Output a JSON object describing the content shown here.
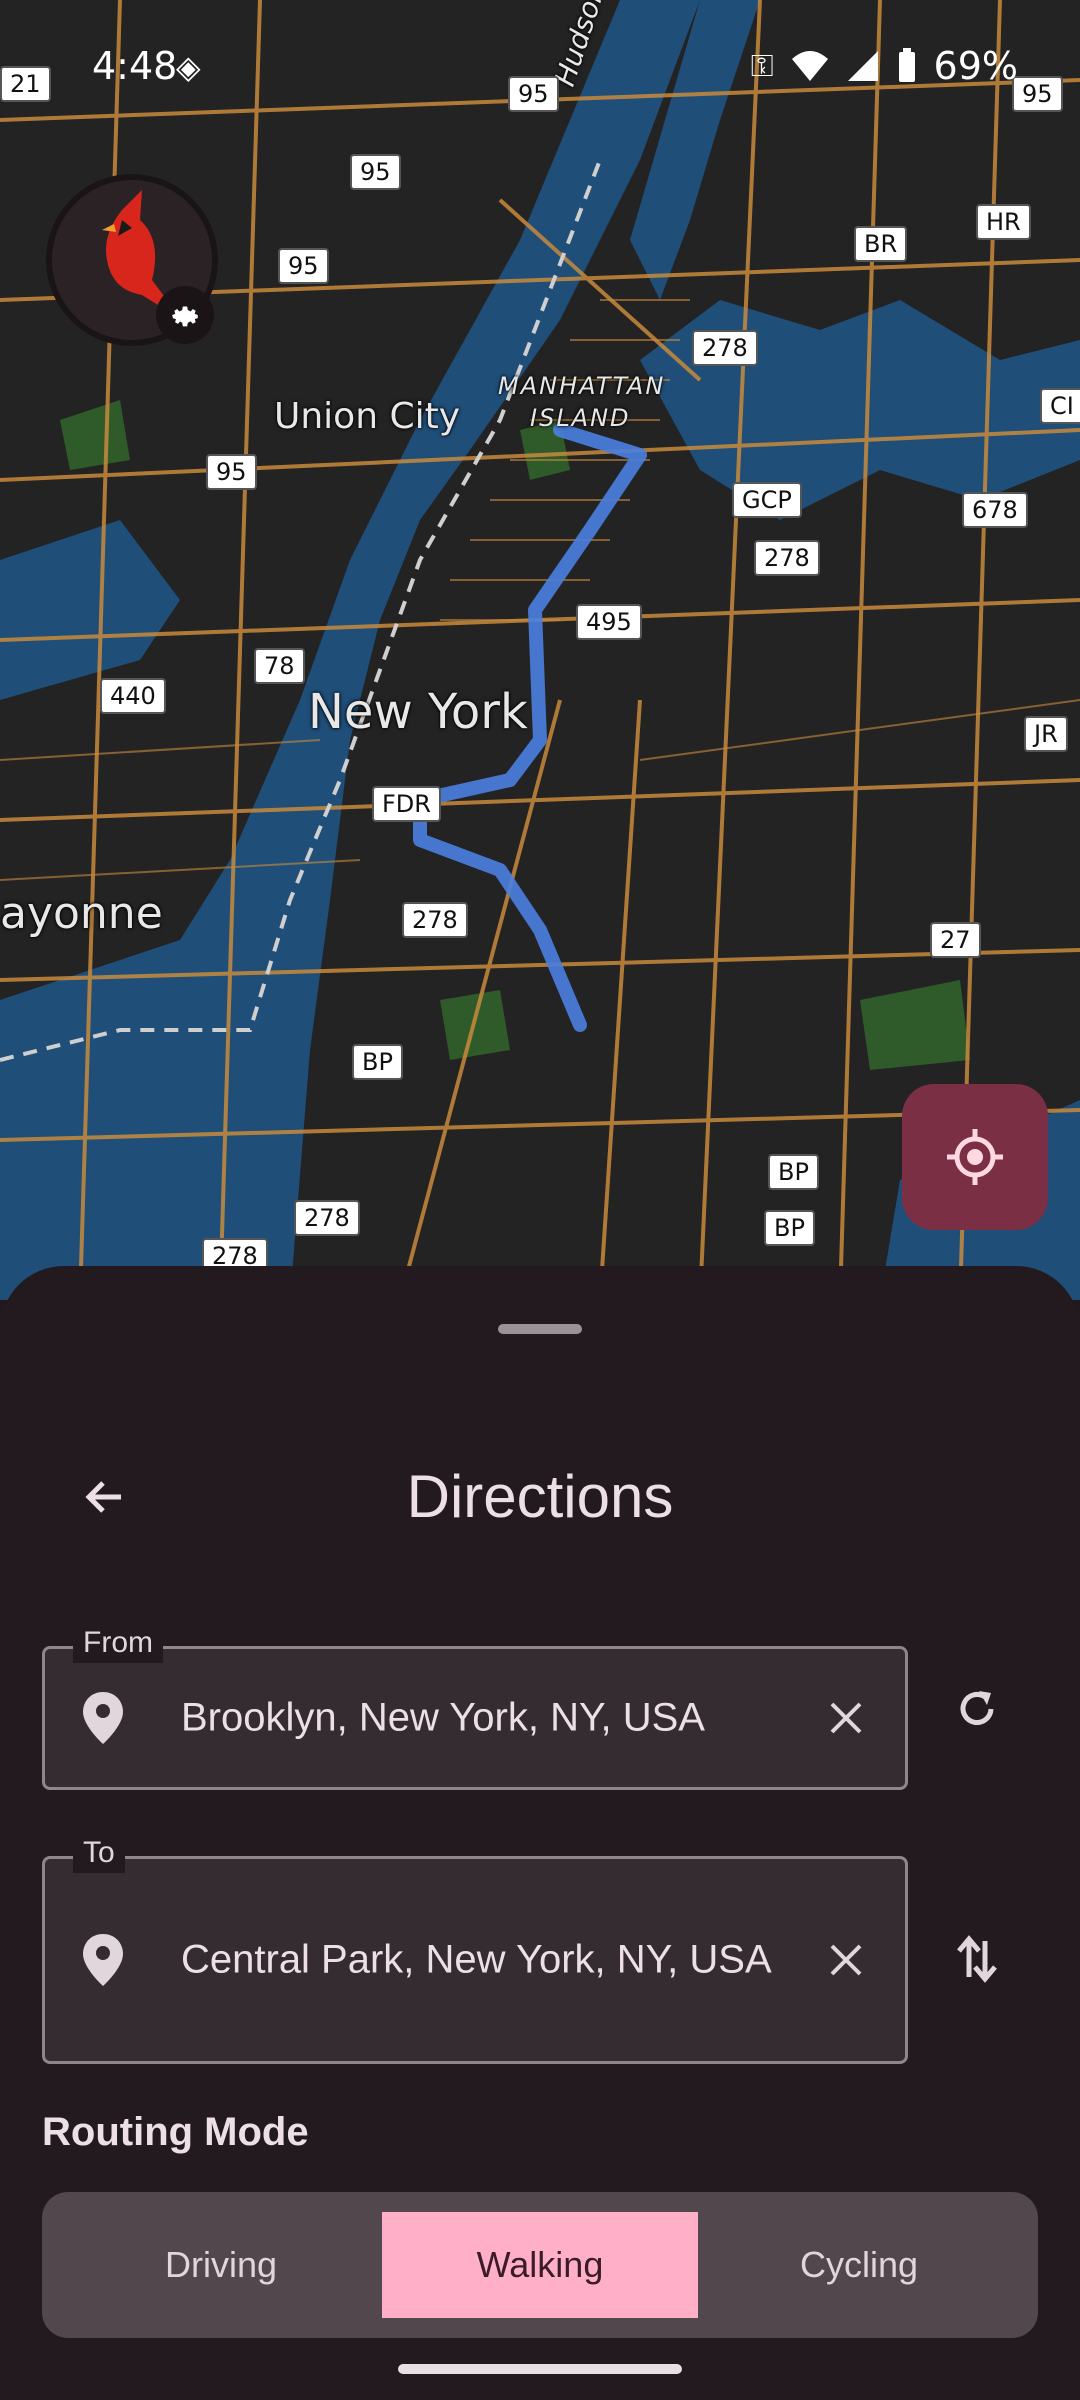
{
  "status_bar": {
    "time": "4:48",
    "battery": "69%"
  },
  "map": {
    "labels": {
      "union_city": "Union City",
      "manhattan": "MANHATTAN",
      "island": "ISLAND",
      "new_york": "New York",
      "bayonne": "ayonne",
      "hudson": "Hudson River"
    },
    "shields": [
      "21",
      "95",
      "95",
      "95",
      "95",
      "95",
      "BR",
      "HR",
      "278",
      "CI",
      "GCP",
      "678",
      "278",
      "495",
      "78",
      "440",
      "JR",
      "FDR",
      "278",
      "27",
      "BP",
      "BP",
      "BP",
      "278",
      "278"
    ]
  },
  "sheet": {
    "title": "Directions",
    "from": {
      "label": "From",
      "value": "Brooklyn, New York, NY, USA"
    },
    "to": {
      "label": "To",
      "value": "Central Park, New York, NY, USA"
    },
    "routing_mode_label": "Routing Mode",
    "modes": [
      "Driving",
      "Walking",
      "Cycling"
    ],
    "selected_mode": "Walking"
  },
  "colors": {
    "accent": "#ffb0c8",
    "fab": "#7a2f45",
    "route": "#4a7fe0",
    "water": "#1f4e79",
    "roads": "#c88a3c"
  }
}
